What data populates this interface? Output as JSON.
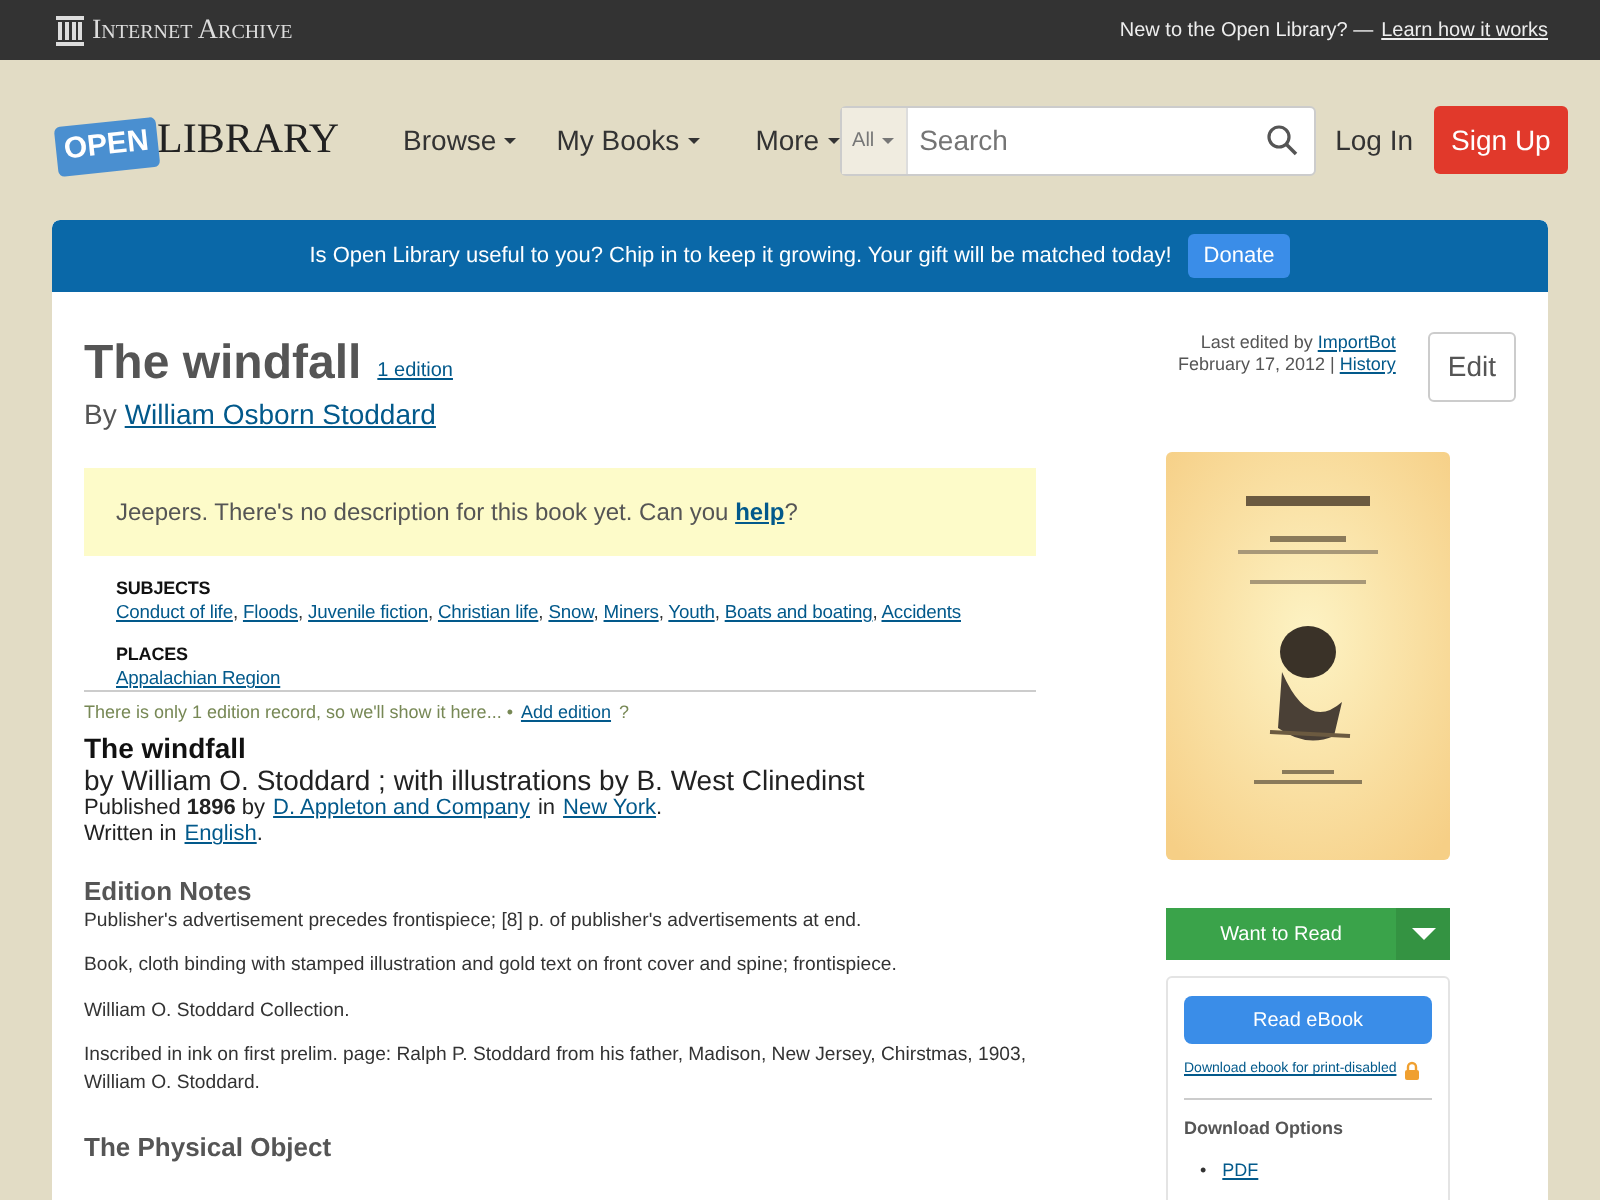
{
  "top_bar": {
    "brand": "Internet Archive",
    "note": "New to the Open Library? —",
    "link": "Learn how it works"
  },
  "header": {
    "logo_badge": "OPEN",
    "logo_text": "LIBRARY",
    "nav": [
      "Browse",
      "My Books",
      "More"
    ],
    "search": {
      "scope": "All",
      "placeholder": "Search"
    },
    "login": "Log In",
    "signup": "Sign Up"
  },
  "banner": {
    "text": "Is Open Library useful to you? Chip in to keep it growing. Your gift will be matched today!",
    "button": "Donate"
  },
  "work": {
    "title": "The windfall",
    "editions_link": "1 edition",
    "by": "By",
    "author": "William Osborn Stoddard",
    "edited_label": "Last edited by",
    "edited_user": "ImportBot",
    "edited_date": "February 17, 2012 |",
    "history": "History",
    "edit": "Edit"
  },
  "description_notice": {
    "text": "Jeepers. There's no description for this book yet. Can you",
    "link": "help",
    "after": "?"
  },
  "subjects": {
    "heading": "SUBJECTS",
    "separator": ",",
    "items": [
      "Conduct of life",
      "Floods",
      "Juvenile fiction",
      "Christian life",
      "Snow",
      "Miners",
      "Youth",
      "Boats and boating",
      "Accidents"
    ]
  },
  "places": {
    "heading": "PLACES",
    "items": [
      "Appalachian Region"
    ]
  },
  "edition": {
    "note": "There is only 1 edition record, so we'll show it here...  •",
    "add_link": "Add edition",
    "add_after": "?",
    "title": "The windfall",
    "byline": "by William O. Stoddard ; with illustrations by B. West Clinedinst",
    "published": "Published **1896** by",
    "publisher": "D. Appleton and Company",
    "in": "in",
    "place": "New York",
    "end": ".",
    "written": "Written in",
    "language": "English",
    "written_end": "."
  },
  "edition_notes": {
    "heading": "Edition Notes",
    "paragraphs": [
      "Publisher's advertisement precedes frontispiece; [8] p. of publisher's advertisements at end.",
      "Book, cloth binding with stamped illustration and gold text on front cover and spine; frontispiece.",
      "William O. Stoddard Collection.",
      "Inscribed in ink on first prelim. page: Ralph P. Stoddard from his father, Madison, New Jersey, Chirstmas, 1903, William O. Stoddard."
    ]
  },
  "physical_object": {
    "heading": "The Physical Object"
  },
  "sidebar": {
    "want_to_read": "Want to Read",
    "read_ebook": "Read eBook",
    "download_link": "Download ebook for print-disabled",
    "download_heading": "Download Options",
    "formats": [
      {
        "bullet": "•",
        "label": "PDF"
      }
    ]
  }
}
